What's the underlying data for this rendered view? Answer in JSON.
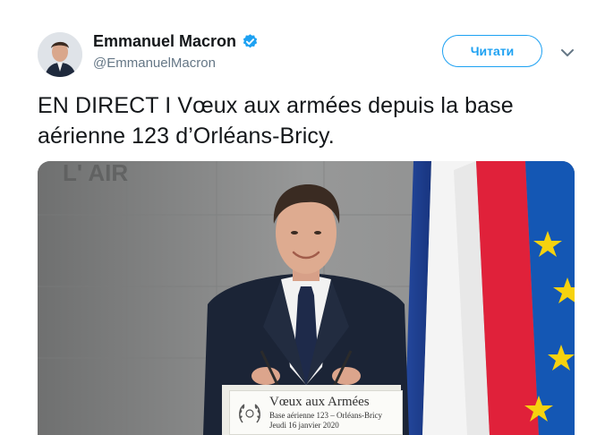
{
  "tweet": {
    "author": {
      "display_name": "Emmanuel Macron",
      "handle": "@EmmanuelMacron",
      "verified_icon": "verified-badge-icon"
    },
    "follow_label": "Читати",
    "menu_icon": "chevron-down-icon",
    "text_line1": "EN DIRECT I Vœux aux armées depuis la base",
    "text_line2": "aérienne 123 d’Orléans-Bricy.",
    "media": {
      "type": "video",
      "podium_title": "Vœux aux Armées",
      "podium_line2": "Base aérienne 123 – Orléans-Bricy",
      "podium_line3": "Jeudi 16 janvier 2020",
      "background_text": "L' AIR"
    }
  },
  "colors": {
    "accent": "#1da1f2",
    "text": "#14171a",
    "muted": "#657786",
    "flag_blue": "#1f3f97",
    "flag_red": "#e0213a",
    "eu_blue": "#1457b4",
    "eu_star": "#f6d20f"
  }
}
